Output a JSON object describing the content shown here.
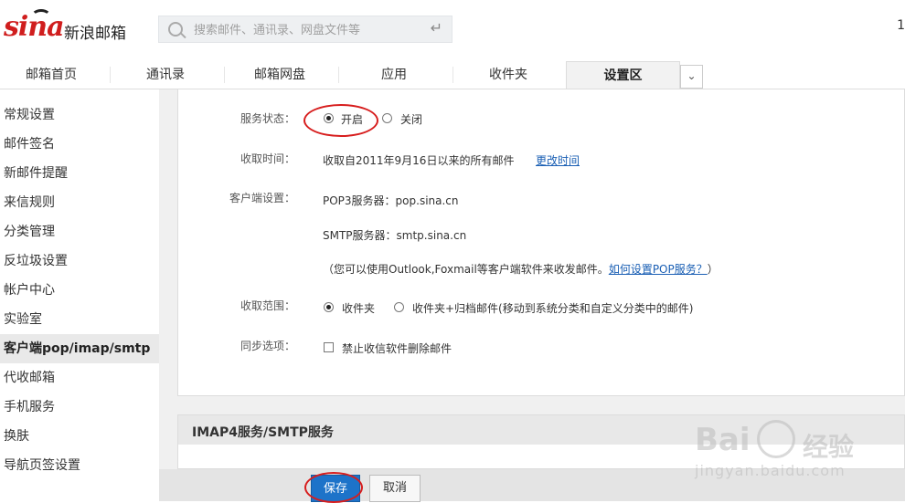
{
  "header": {
    "logo_text": "sina",
    "mail_name": "新浪邮箱",
    "search_placeholder": "搜索邮件、通讯录、网盘文件等",
    "corner_number": "1"
  },
  "tabs": [
    "邮箱首页",
    "通讯录",
    "邮箱网盘",
    "应用",
    "收件夹",
    "设置区"
  ],
  "active_tab": "设置区",
  "sidebar": {
    "items": [
      "常规设置",
      "邮件签名",
      "新邮件提醒",
      "来信规则",
      "分类管理",
      "反垃圾设置",
      "帐户中心",
      "实验室",
      "客户端pop/imap/smtp",
      "代收邮箱",
      "手机服务",
      "换肤",
      "导航页签设置"
    ],
    "active": "客户端pop/imap/smtp"
  },
  "settings": {
    "service_status_label": "服务状态：",
    "on_label": "开启",
    "off_label": "关闭",
    "receive_time_label": "收取时间：",
    "receive_time_value": "收取自2011年9月16日以来的所有邮件",
    "change_time_link": "更改时间",
    "client_label": "客户端设置：",
    "pop3_server": "POP3服务器：pop.sina.cn",
    "smtp_server": "SMTP服务器：smtp.sina.cn",
    "note_prefix": "（您可以使用Outlook,Foxmail等客户端软件来收发邮件。",
    "note_link": "如何设置POP服务？",
    "note_suffix": "）",
    "range_label": "收取范围：",
    "range_opt1": "收件夹",
    "range_opt2": "收件夹+归档邮件(移动到系统分类和自定义分类中的邮件)",
    "sync_label": "同步选项：",
    "sync_opt": "禁止收信软件删除邮件"
  },
  "imap_section_title": "IMAP4服务/SMTP服务",
  "buttons": {
    "save": "保存",
    "cancel": "取消"
  },
  "watermark": {
    "brand": "Bai",
    "brand_cn": "经验",
    "url": "jingyan.baidu.com"
  },
  "colors": {
    "brand_red": "#d01e1e",
    "save_blue": "#1d73c9",
    "link_blue": "#1a5fb4",
    "annotation_red": "#d71d1d"
  }
}
